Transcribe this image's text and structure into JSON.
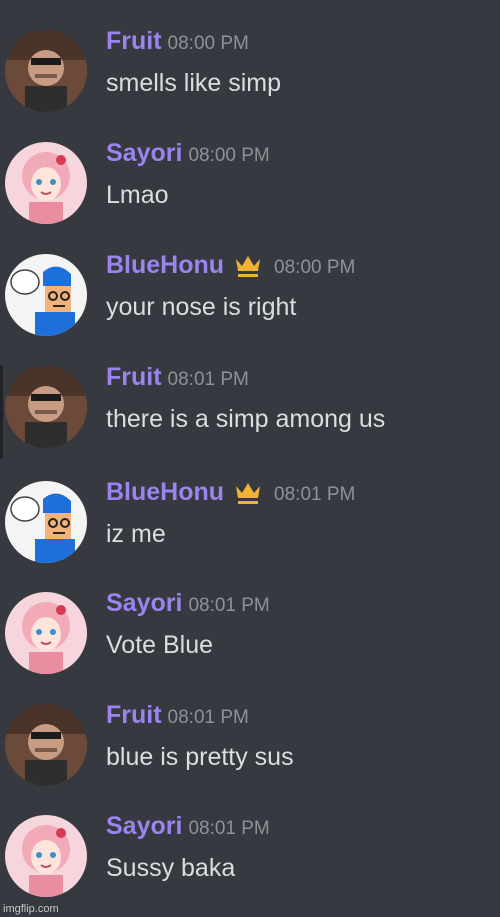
{
  "colors": {
    "background": "#36393f",
    "username": "#9b84ee",
    "timestamp": "#8e9297",
    "message_text": "#dcddde",
    "crown": "#f0b232"
  },
  "messages": [
    {
      "author": "Fruit",
      "time": "08:00 PM",
      "text": "smells like simp",
      "avatar": "fruit-avatar",
      "crown": false
    },
    {
      "author": "Sayori",
      "time": "08:00 PM",
      "text": "Lmao",
      "avatar": "sayori-avatar",
      "crown": false
    },
    {
      "author": "BlueHonu",
      "time": "08:00 PM",
      "text": "your nose is right",
      "avatar": "bluehonu-avatar",
      "crown": true
    },
    {
      "author": "Fruit",
      "time": "08:01 PM",
      "text": "there is a simp among us",
      "avatar": "fruit-avatar",
      "crown": false
    },
    {
      "author": "BlueHonu",
      "time": "08:01 PM",
      "text": "iz me",
      "avatar": "bluehonu-avatar",
      "crown": true
    },
    {
      "author": "Sayori",
      "time": "08:01 PM",
      "text": "Vote Blue",
      "avatar": "sayori-avatar",
      "crown": false
    },
    {
      "author": "Fruit",
      "time": "08:01 PM",
      "text": "blue is pretty sus",
      "avatar": "fruit-avatar",
      "crown": false
    },
    {
      "author": "Sayori",
      "time": "08:01 PM",
      "text": "Sussy baka",
      "avatar": "sayori-avatar",
      "crown": false
    }
  ],
  "watermark": "imgflip.com"
}
